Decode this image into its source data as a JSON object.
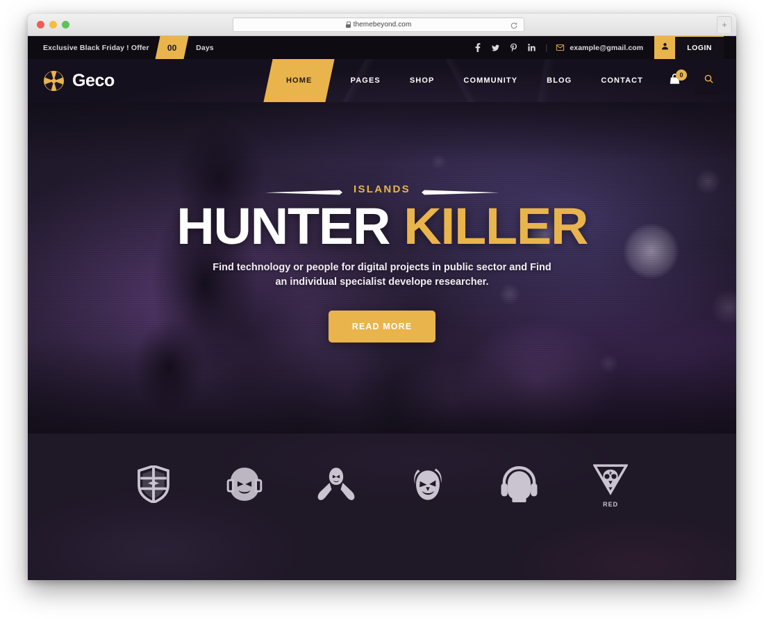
{
  "browser": {
    "url": "themebeyond.com",
    "lock_icon": "lock-icon",
    "reload_icon": "reload-icon",
    "new_tab_label": "+",
    "traffic_lights": [
      "close",
      "minimize",
      "maximize"
    ]
  },
  "topbar": {
    "promo_text": "Exclusive Black Friday ! Offer",
    "promo_count": "00",
    "promo_unit": "Days",
    "social": [
      {
        "name": "facebook",
        "glyph": "f"
      },
      {
        "name": "twitter",
        "glyph": "ᵗ"
      },
      {
        "name": "pinterest",
        "glyph": "P"
      },
      {
        "name": "linkedin",
        "glyph": "in"
      }
    ],
    "separator": "|",
    "email": "example@gmail.com",
    "mail_icon": "envelope-icon",
    "account_icon": "user-icon",
    "login_label": "LOGIN"
  },
  "header": {
    "logo_text": "Geco",
    "logo_icon": "aperture-icon",
    "nav": [
      {
        "label": "HOME",
        "active": true
      },
      {
        "label": "PAGES",
        "active": false
      },
      {
        "label": "SHOP",
        "active": false
      },
      {
        "label": "COMMUNITY",
        "active": false
      },
      {
        "label": "BLOG",
        "active": false
      },
      {
        "label": "CONTACT",
        "active": false
      }
    ],
    "cart_icon": "cart-icon",
    "cart_count": "0",
    "search_icon": "search-icon"
  },
  "hero": {
    "eyebrow": "ISLANDS",
    "title_word_1": "HUNTER",
    "title_word_2": "KILLER",
    "subtitle": "Find technology or people for digital projects in public sector and Find an individual specialist develope researcher.",
    "cta_label": "READ MORE"
  },
  "brands": {
    "items": [
      {
        "name": "shield-crest-logo",
        "label": ""
      },
      {
        "name": "gamer-headset-face-logo",
        "label": ""
      },
      {
        "name": "masked-gamepad-logo",
        "label": ""
      },
      {
        "name": "horned-demon-logo",
        "label": ""
      },
      {
        "name": "headphones-head-logo",
        "label": ""
      },
      {
        "name": "red-gasmask-logo",
        "label": "RED"
      }
    ]
  },
  "colors": {
    "accent": "#e9b44c",
    "topbar_bg": "#0e0b12",
    "header_bg": "#15101d",
    "page_bg": "#1f1827",
    "text_light": "#ffffff"
  }
}
